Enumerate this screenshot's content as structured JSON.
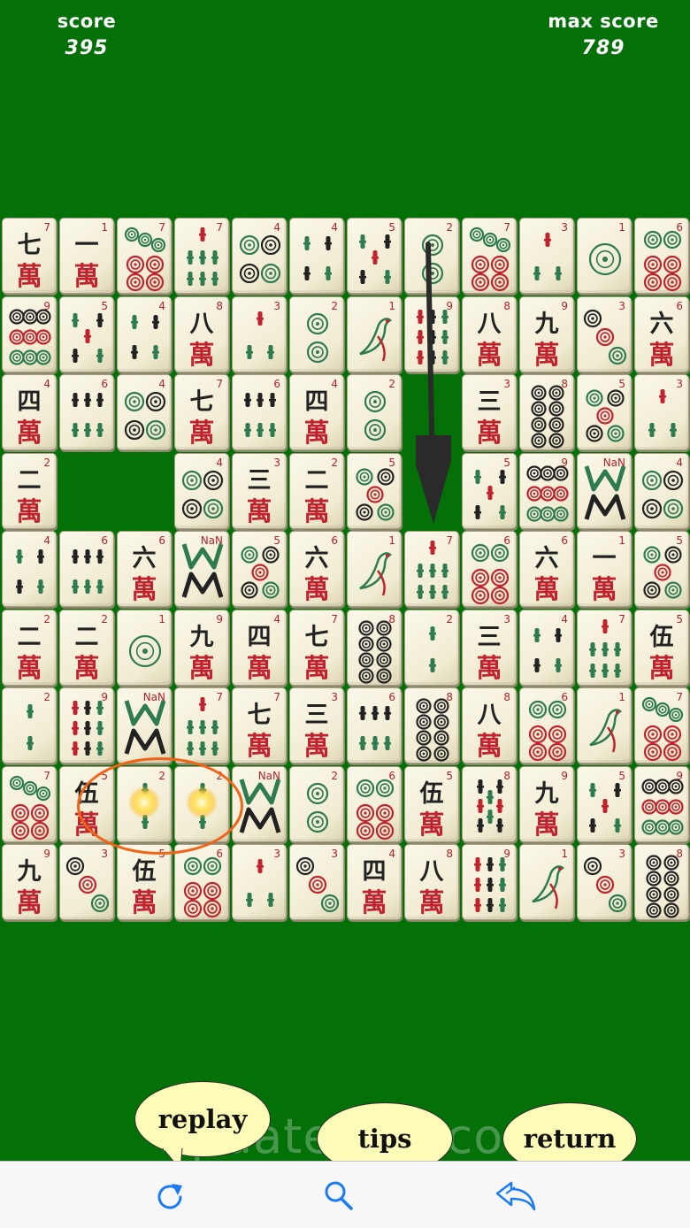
{
  "hud": {
    "score_label": "score",
    "score_value": "395",
    "max_score_label": "max score",
    "max_score_value": "789"
  },
  "tiles": [
    [
      "w7",
      "w1",
      "c7",
      "b7",
      "c4",
      "b4",
      "b5",
      "c2",
      "c7",
      "b3",
      "c1",
      "c6"
    ],
    [
      "c9",
      "b5",
      "b4",
      "w8",
      "b3",
      "c2",
      "b1",
      "b9",
      "w8",
      "w9",
      "c3",
      "w6"
    ],
    [
      "w4",
      "b6",
      "c4",
      "w7",
      "b6",
      "w4",
      "c2",
      null,
      "w3",
      "c8",
      "c5",
      "b3"
    ],
    [
      "w2",
      null,
      null,
      "c4",
      "w3",
      "w2",
      "c5",
      null,
      "b5",
      "c9",
      "D",
      "c4"
    ],
    [
      "b4",
      "b6",
      "w6",
      "D",
      "c5",
      "w6",
      "b1",
      "b7",
      "c6",
      "w6",
      "w1",
      "c5"
    ],
    [
      "w2",
      "w2",
      "c1",
      "w9",
      "w4",
      "w7",
      "c8",
      "b2",
      "w3",
      "b4",
      "b7",
      "w5"
    ],
    [
      "b2",
      "b9",
      "D",
      "b7",
      "w7",
      "w3",
      "b6",
      "c8",
      "w8",
      "c6",
      "b1",
      "c7"
    ],
    [
      "c7",
      "w5",
      "b2",
      "b2",
      "D",
      "c2",
      "c6",
      "w5",
      "b8",
      "w9",
      "b5",
      "c9"
    ],
    [
      "w9",
      "c3",
      "w5",
      "c6",
      "b3",
      "c3",
      "w4",
      "w8",
      "b9",
      "b1",
      "c3",
      "c8"
    ]
  ],
  "tile_faces": {
    "w": [
      "一",
      "二",
      "三",
      "四",
      "伍",
      "六",
      "七",
      "八",
      "九"
    ],
    "wan": "萬"
  },
  "highlighted_tiles": [
    [
      7,
      2
    ],
    [
      7,
      3
    ]
  ],
  "bubbles": {
    "replay": "replay",
    "tips": "tips",
    "return": "return"
  },
  "watermark": "UpdateStar.com",
  "toolbar": {
    "replay_icon": "replay-icon",
    "tips_icon": "search-icon",
    "return_icon": "return-arrow-icon",
    "icon_color": "#1a7cf5"
  },
  "colors": {
    "felt": "#037008",
    "circle_green": "#2e7b4f",
    "circle_red": "#c0232d",
    "circle_black": "#222222",
    "highlight_ring": "#ef6417"
  }
}
